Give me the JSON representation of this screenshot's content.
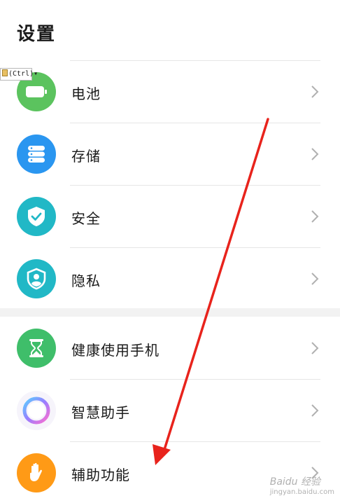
{
  "page": {
    "title": "设置"
  },
  "overlay": {
    "ctrl_badge": "(Ctrl)",
    "ctrl_caret": "▾"
  },
  "rows": [
    {
      "label": "电池",
      "icon": "battery-icon",
      "color": "#5bc35e"
    },
    {
      "label": "存储",
      "icon": "storage-icon",
      "color": "#2a96f0"
    },
    {
      "label": "安全",
      "icon": "shield-check-icon",
      "color": "#21b8c6"
    },
    {
      "label": "隐私",
      "icon": "privacy-shield-icon",
      "color": "#21b8c6"
    },
    {
      "label": "健康使用手机",
      "icon": "hourglass-icon",
      "color": "#3fbe6a"
    },
    {
      "label": "智慧助手",
      "icon": "assistant-ring-icon",
      "color": "#9a7cff"
    },
    {
      "label": "辅助功能",
      "icon": "hand-icon",
      "color": "#ff9a16"
    }
  ],
  "annotation": {
    "arrow_color": "#e8231c"
  },
  "watermark": {
    "brand": "Baidu 经验",
    "url": "jingyan.baidu.com"
  }
}
